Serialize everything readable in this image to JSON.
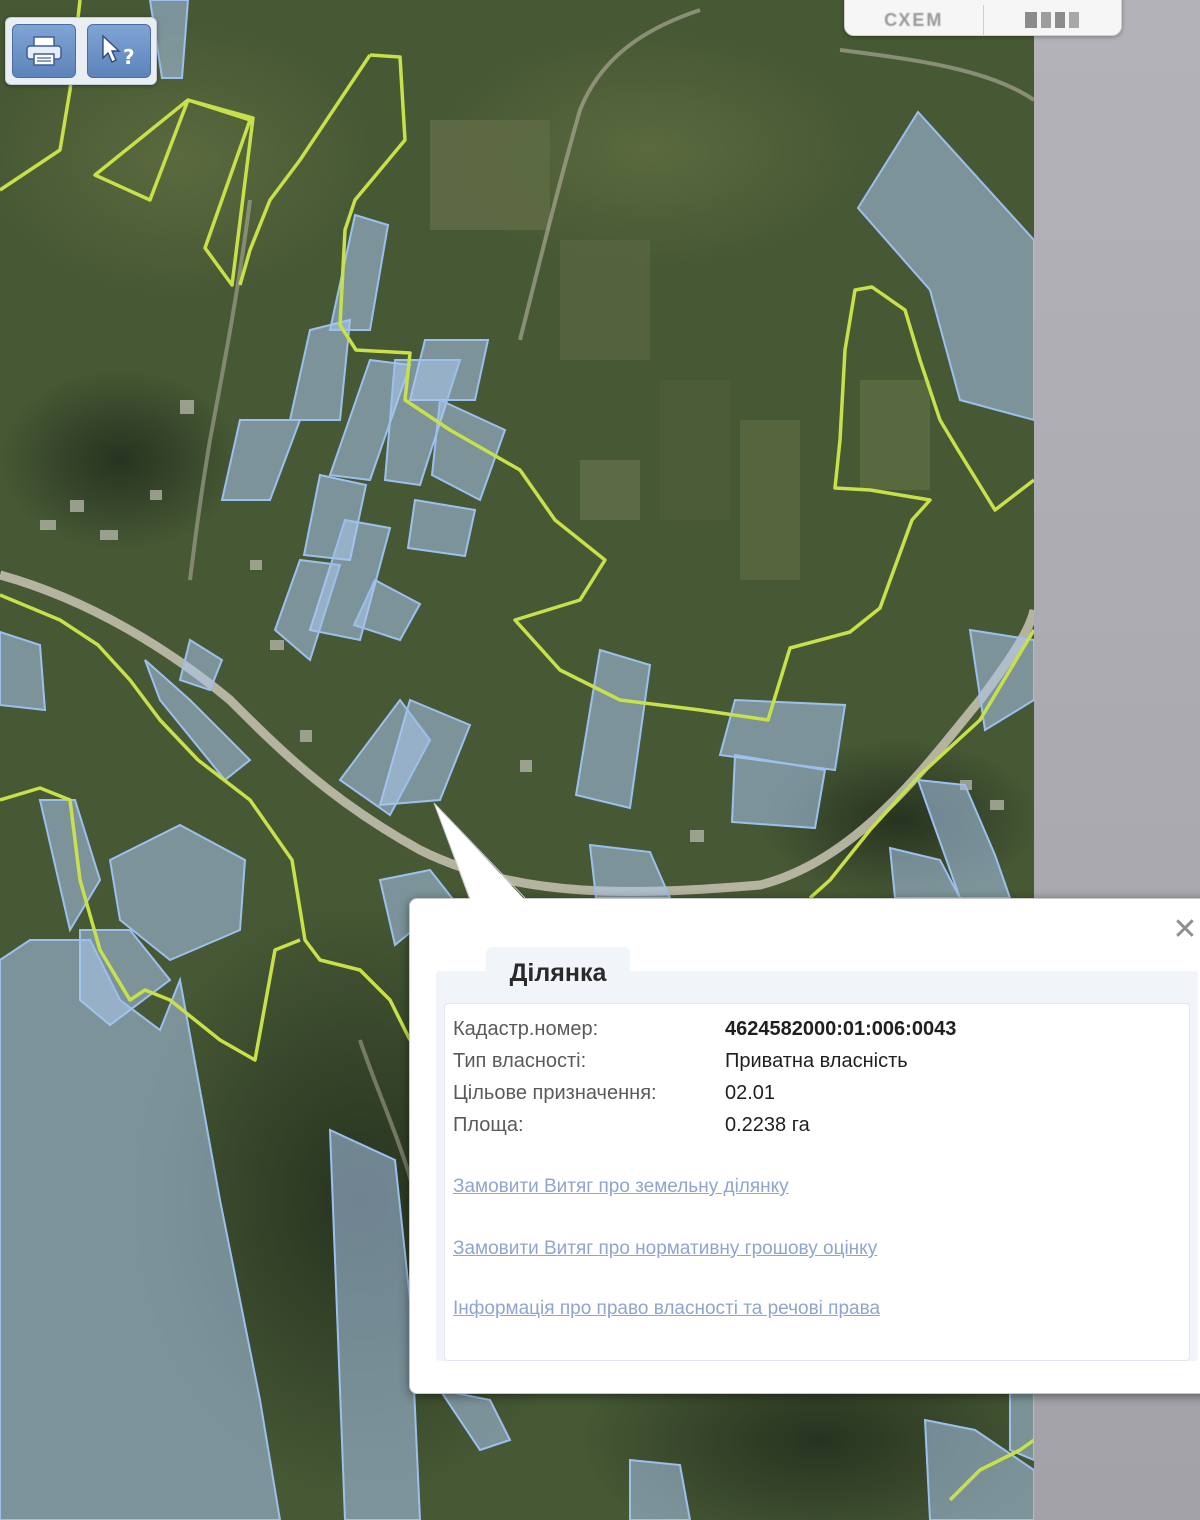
{
  "toolbar": {
    "print_icon": "printer-icon",
    "help_icon": "cursor-help-icon"
  },
  "layer_switcher": {
    "items": [
      {
        "label": "СХЕМ",
        "icon": "map-layer-icon"
      },
      {
        "label": "",
        "icon": "satellite-layer-icon"
      }
    ]
  },
  "popup": {
    "tab_label": "Ділянка",
    "close_icon": "close-icon",
    "fields": [
      {
        "label": "Кадастр.номер:",
        "value": "4624582000:01:006:0043"
      },
      {
        "label": "Тип власності:",
        "value": "Приватна власність"
      },
      {
        "label": "Цільове призначення:",
        "value": "02.01"
      },
      {
        "label": "Площа:",
        "value": "0.2238 га"
      }
    ],
    "links": [
      "Замовити Витяг про земельну ділянку",
      "Замовити Витяг про нормативну грошову оцінку",
      "Інформація про право власності та речові права"
    ]
  },
  "colors": {
    "parcel_fill": "#a9c7ec",
    "parcel_stroke": "#9cc0ee",
    "boundary": "#c8e04a",
    "road": "#c9c4b4",
    "link": "#8fa5d0"
  }
}
